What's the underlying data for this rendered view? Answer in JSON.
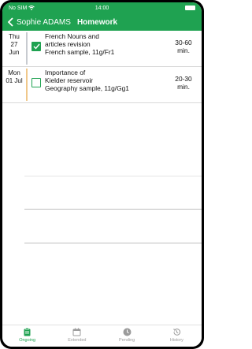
{
  "status_bar": {
    "carrier": "No SIM",
    "time": "14:00"
  },
  "nav": {
    "back_label": "Sophie ADAMS",
    "title": "Homework"
  },
  "homework": [
    {
      "day": "Thu",
      "date": "27",
      "month": "Jun",
      "checked": true,
      "title_line1": "French Nouns and",
      "title_line2": "articles revision",
      "detail": "French sample, 11g/Fr1",
      "duration_line1": "30-60",
      "duration_line2": "min."
    },
    {
      "day": "Mon",
      "date": "01 Jul",
      "month": "",
      "checked": false,
      "title_line1": "Importance of",
      "title_line2": "Kielder reservoir",
      "detail": "Geography sample, 11g/Gg1",
      "duration_line1": "20-30",
      "duration_line2": "min."
    }
  ],
  "tabs": [
    {
      "label": "Ongoing",
      "icon": "clipboard-icon",
      "active": true
    },
    {
      "label": "Extended",
      "icon": "calendar-icon",
      "active": false
    },
    {
      "label": "Pending",
      "icon": "clock-icon",
      "active": false
    },
    {
      "label": "History",
      "icon": "history-icon",
      "active": false
    }
  ],
  "colors": {
    "accent": "#1fa251",
    "stripe_first": "#c8cbd0",
    "stripe_second": "#f0c88b"
  }
}
